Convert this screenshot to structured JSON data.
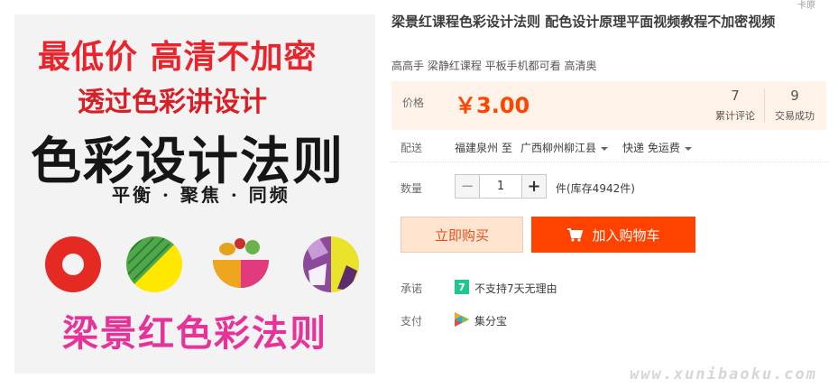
{
  "image": {
    "promo_top": "最低价  高清不加密",
    "subtitle_banner": "透过色彩讲设计",
    "big_title": "色彩设计法则",
    "tagline": "平衡 · 聚焦 · 同频",
    "author_banner": "梁景红色彩法则"
  },
  "product": {
    "title": "梁景红课程色彩设计法则 配色设计原理平面视频教程不加密视频",
    "subtitle": "高高手 梁静红课程 平板手机都可看 高清奥"
  },
  "price": {
    "label": "价格",
    "value": "￥3.00",
    "reviews_count": "7",
    "reviews_label": "累计评论",
    "sales_count": "9",
    "sales_label": "交易成功"
  },
  "shipping": {
    "label": "配送",
    "from": "福建泉州 至",
    "to": "广西柳州柳江县",
    "method": "快递 免运费"
  },
  "quantity": {
    "label": "数量",
    "minus": "−",
    "value": "1",
    "plus": "+",
    "stock": "件(库存4942件)"
  },
  "actions": {
    "buy_now": "立即购买",
    "add_to_cart": "加入购物车"
  },
  "promise": {
    "label": "承诺",
    "badge": "7",
    "text": "不支持7天无理由"
  },
  "payment": {
    "label": "支付",
    "text": "集分宝"
  },
  "corner_fragment": "卡原",
  "watermark": "www.xunibaoku.com",
  "colors": {
    "price": "#ff4400",
    "cart_button": "#ff4200",
    "buy_button_bg": "#ffe4d0",
    "price_box_bg": "#fff2e8",
    "promo_red": "#e8242c",
    "author_pink": "#e6339a"
  }
}
